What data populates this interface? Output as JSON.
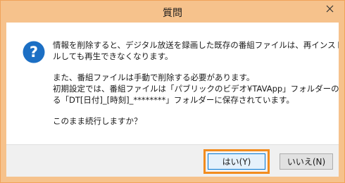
{
  "dialog": {
    "title": "質問",
    "icon": "question-icon",
    "message": {
      "para1": [
        "情報を削除すると、デジタル放送を録画した既存の番組ファイルは、再インストー",
        "ルしても再生できなくなります。"
      ],
      "para2": [
        "また、番組ファイルは手動で削除する必要があります。",
        "初期設定では、番組ファイルは「パブリックのビデオ¥TAVApp」フォルダーの下にあ",
        "る「DT[日付]_[時刻]_********」フォルダーに保存されています。"
      ],
      "para3": [
        "このまま続行しますか？"
      ]
    },
    "buttons": {
      "yes_label": "はい(Y)",
      "no_label": "いいえ(N)"
    }
  },
  "colors": {
    "titlebar": "#f6c28c",
    "focus_highlight": "#f28c1e",
    "icon_blue": "#1c6fc4"
  }
}
